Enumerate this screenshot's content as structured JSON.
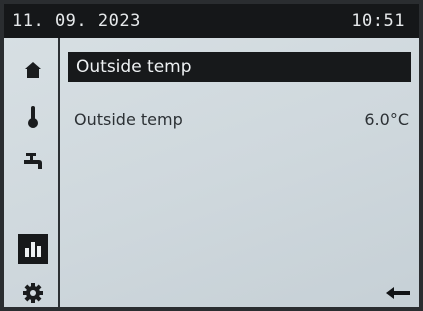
{
  "status_bar": {
    "date": "11. 09. 2023",
    "time": "10:51"
  },
  "sidebar": {
    "items": [
      {
        "icon": "home-icon",
        "active": false
      },
      {
        "icon": "thermometer-icon",
        "active": false
      },
      {
        "icon": "faucet-icon",
        "active": false
      },
      {
        "icon": "bar-chart-icon",
        "active": true
      },
      {
        "icon": "gear-icon",
        "active": false
      }
    ]
  },
  "main": {
    "title": "Outside temp",
    "rows": [
      {
        "label": "Outside temp",
        "value": "6.0°C"
      }
    ]
  },
  "footer": {
    "back_icon": "back-arrow-icon"
  },
  "colors": {
    "panel_dark": "#17191b",
    "screen_bg": "#d3dbe0",
    "text": "#2c3135"
  }
}
